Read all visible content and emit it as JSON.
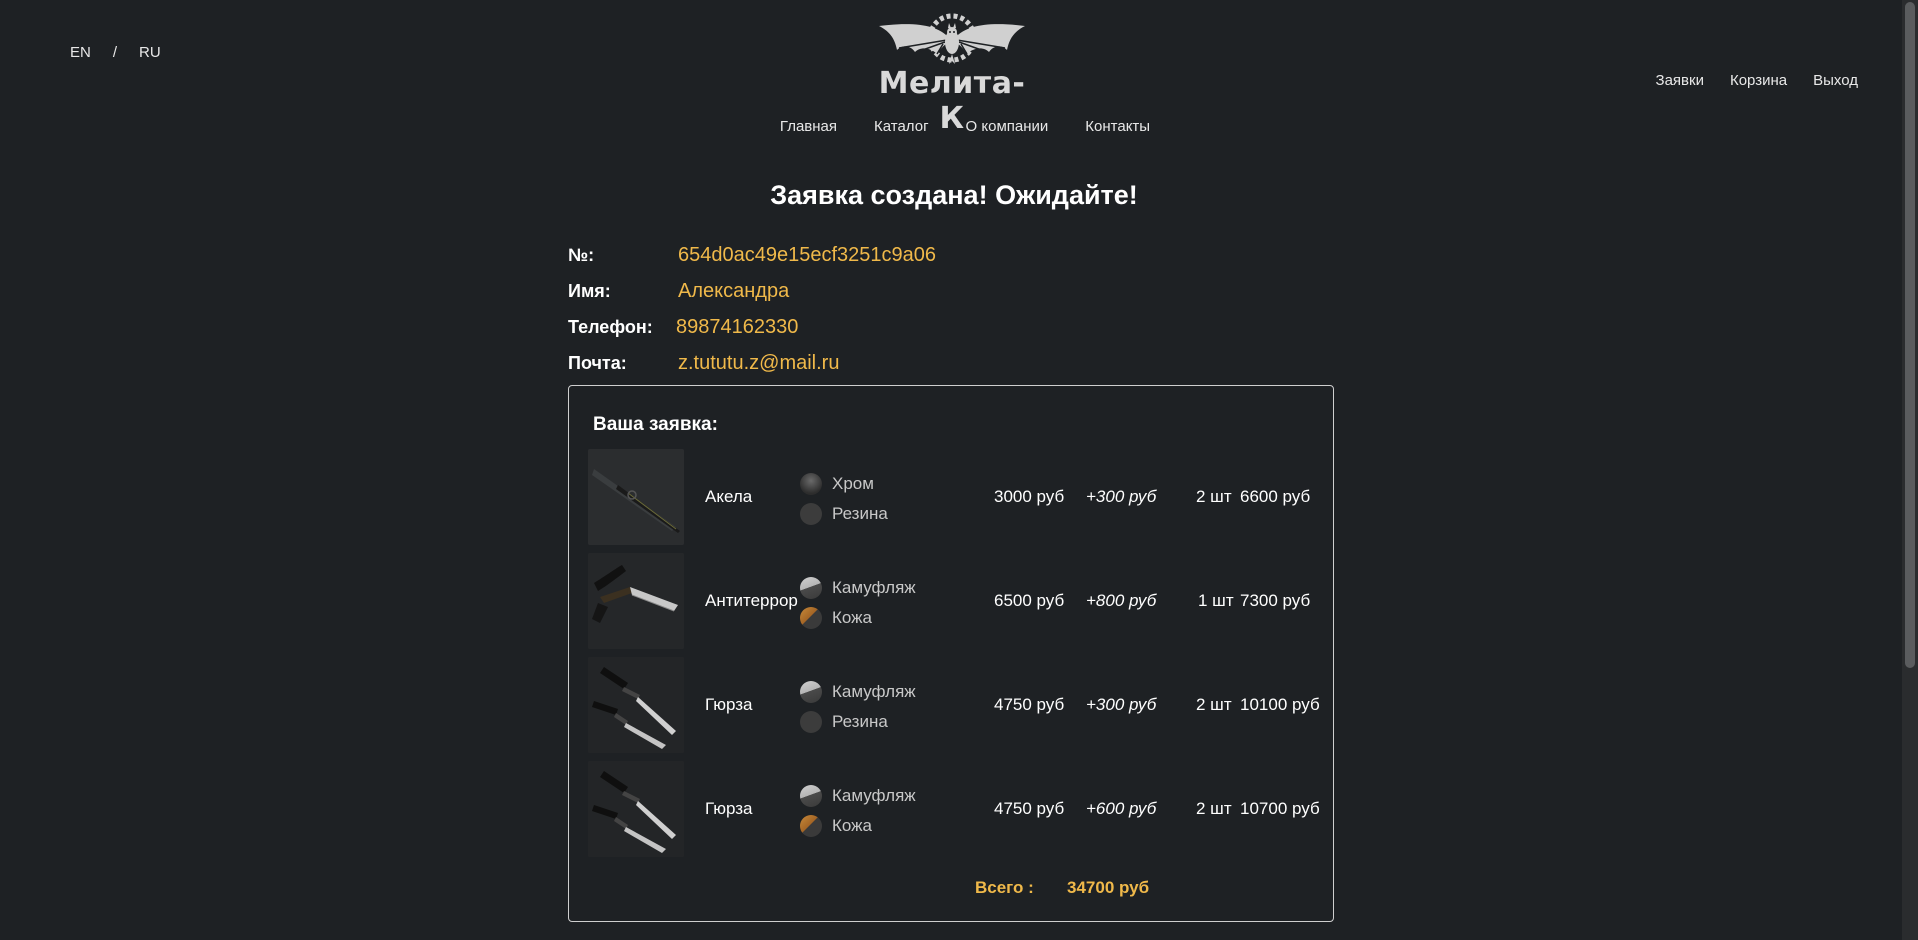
{
  "lang": {
    "en": "EN",
    "sep": "/",
    "ru": "RU"
  },
  "logo": {
    "text": "Мелита-К"
  },
  "nav": [
    "Главная",
    "Каталог",
    "О компании",
    "Контакты"
  ],
  "user_nav": [
    "Заявки",
    "Корзина",
    "Выход"
  ],
  "heading": "Заявка создана! Ожидайте!",
  "info": {
    "number_label": "№:",
    "number": "654d0ac49e15ecf3251c9a06",
    "name_label": "Имя:",
    "name": "Александра",
    "phone_label": "Телефон:",
    "phone": "89874162330",
    "email_label": "Почта:",
    "email": "z.tututu.z@mail.ru"
  },
  "order": {
    "title": "Ваша заявка:",
    "items": [
      {
        "name": "Акела",
        "options": [
          {
            "label": "Хром",
            "swatch": "chrome"
          },
          {
            "label": "Резина",
            "swatch": "rubber"
          }
        ],
        "price": "3000 руб",
        "extra": "+300 руб",
        "qty": "2 шт",
        "total": "6600 руб",
        "image_icon": "knife-akela-icon"
      },
      {
        "name": "Антитеррор",
        "options": [
          {
            "label": "Камуфляж",
            "swatch": "camo"
          },
          {
            "label": "Кожа",
            "swatch": "leather"
          }
        ],
        "price": "6500 руб",
        "extra": "+800 руб",
        "qty": "1 шт",
        "total": "7300 руб",
        "image_icon": "knife-antiterror-icon"
      },
      {
        "name": "Гюрза",
        "options": [
          {
            "label": "Камуфляж",
            "swatch": "camo"
          },
          {
            "label": "Резина",
            "swatch": "rubber"
          }
        ],
        "price": "4750 руб",
        "extra": "+300 руб",
        "qty": "2 шт",
        "total": "10100 руб",
        "image_icon": "knife-gyurza-icon"
      },
      {
        "name": "Гюрза",
        "options": [
          {
            "label": "Камуфляж",
            "swatch": "camo"
          },
          {
            "label": "Кожа",
            "swatch": "leather"
          }
        ],
        "price": "4750 руб",
        "extra": "+600 руб",
        "qty": "2 шт",
        "total": "10700 руб",
        "image_icon": "knife-gyurza-icon"
      }
    ],
    "total_label": "Всего :",
    "total_value": "34700 руб"
  },
  "colors": {
    "background": "#1e2124",
    "accent": "#f0b94a",
    "text": "#ffffff"
  }
}
